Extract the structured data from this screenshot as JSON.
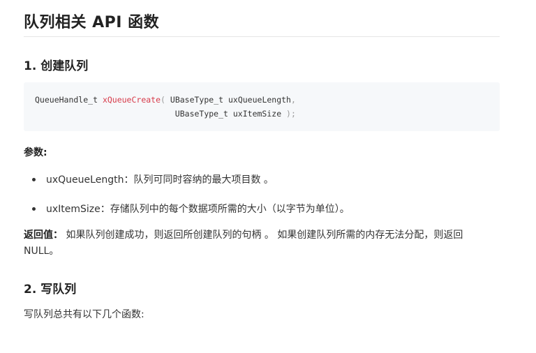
{
  "page": {
    "title": "队列相关 API 函数",
    "section1": {
      "heading": "1. 创建队列",
      "code": {
        "line1_prefix": "QueueHandle_t ",
        "line1_function": "xQueueCreate",
        "line1_open": "( ",
        "line1_param": "UBaseType_t uxQueueLength",
        "line1_comma": ",",
        "line2_indent": "                             ",
        "line2_param": "UBaseType_t uxItemSize",
        "line2_close": " );"
      },
      "params_label": "参数:",
      "params": [
        {
          "text": "uxQueueLength：队列可同时容纳的最大项目数 。"
        },
        {
          "text": "uxItemSize：存储队列中的每个数据项所需的大小（以字节为单位）。"
        }
      ],
      "return_label": "返回值：",
      "return_text": "如果队列创建成功，则返回所创建队列的句柄 。 如果创建队列所需的内存无法分配，则返回 NULL。"
    },
    "section2": {
      "heading": "2. 写队列",
      "intro": "写队列总共有以下几个函数:"
    }
  }
}
